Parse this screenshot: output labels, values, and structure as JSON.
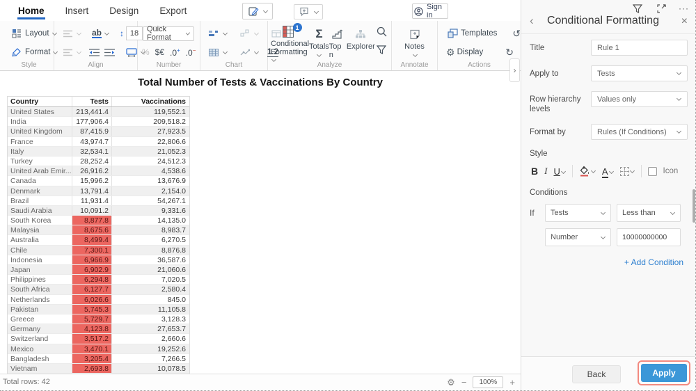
{
  "menubar": {
    "tabs": [
      {
        "label": "Home",
        "active": true
      },
      {
        "label": "Insert",
        "active": false
      },
      {
        "label": "Design",
        "active": false
      },
      {
        "label": "Export",
        "active": false
      }
    ],
    "sign_in_label": "Sign in"
  },
  "ribbon": {
    "style": {
      "label": "Style",
      "layout_label": "Layout",
      "format_label": "Format"
    },
    "align": {
      "label": "Align",
      "ab_label": "ab",
      "font_size": "18"
    },
    "number": {
      "label": "Number",
      "quick_format_label": "Quick Format",
      "percent": "%",
      "currency": "$€",
      "dec_plus": ".0",
      "dec_minus": ".0"
    },
    "chart": {
      "label": "Chart",
      "decimal_label": "1.2"
    },
    "analyze": {
      "label": "Analyze",
      "conditional_formatting_line1": "Conditional",
      "conditional_formatting_line2": "Formatting",
      "badge": "1",
      "totals_label": "Totals",
      "top_n_label": "Top n",
      "explorer_label": "Explorer"
    },
    "annotate": {
      "label": "Annotate",
      "notes_label": "Notes"
    },
    "actions": {
      "label": "Actions",
      "templates_label": "Templates",
      "display_label": "Display"
    }
  },
  "icons": {
    "undo": "↺",
    "redo": "↻",
    "resize": "↔",
    "gear": "⚙",
    "sigma": "Σ",
    "more": "···",
    "close": "×",
    "back": "‹",
    "collapse": "›",
    "minus": "−",
    "plus": "+",
    "updown": "↕",
    "excel_x": "x"
  },
  "report": {
    "title": "Total Number of Tests & Vaccinations By Country",
    "table": {
      "columns": [
        "Country",
        "Tests",
        "Vaccinations"
      ],
      "rows": [
        {
          "country": "United States",
          "tests": "213,441.4",
          "vaccinations": "119,552.1",
          "highlight": false
        },
        {
          "country": "India",
          "tests": "177,906.4",
          "vaccinations": "209,518.2",
          "highlight": false
        },
        {
          "country": "United Kingdom",
          "tests": "87,415.9",
          "vaccinations": "27,923.5",
          "highlight": false
        },
        {
          "country": "France",
          "tests": "43,974.7",
          "vaccinations": "22,806.6",
          "highlight": false
        },
        {
          "country": "Italy",
          "tests": "32,534.1",
          "vaccinations": "21,052.3",
          "highlight": false
        },
        {
          "country": "Turkey",
          "tests": "28,252.4",
          "vaccinations": "24,512.3",
          "highlight": false
        },
        {
          "country": "United Arab Emir...",
          "tests": "26,916.2",
          "vaccinations": "4,538.6",
          "highlight": false
        },
        {
          "country": "Canada",
          "tests": "15,996.2",
          "vaccinations": "13,676.9",
          "highlight": false
        },
        {
          "country": "Denmark",
          "tests": "13,791.4",
          "vaccinations": "2,154.0",
          "highlight": false
        },
        {
          "country": "Brazil",
          "tests": "11,931.4",
          "vaccinations": "54,267.1",
          "highlight": false
        },
        {
          "country": "Saudi Arabia",
          "tests": "10,091.2",
          "vaccinations": "9,331.6",
          "highlight": false
        },
        {
          "country": "South Korea",
          "tests": "8,877.8",
          "vaccinations": "14,135.0",
          "highlight": true
        },
        {
          "country": "Malaysia",
          "tests": "8,675.6",
          "vaccinations": "8,983.7",
          "highlight": true
        },
        {
          "country": "Australia",
          "tests": "8,499.4",
          "vaccinations": "6,270.5",
          "highlight": true
        },
        {
          "country": "Chile",
          "tests": "7,300.1",
          "vaccinations": "8,876.8",
          "highlight": true
        },
        {
          "country": "Indonesia",
          "tests": "6,966.9",
          "vaccinations": "36,587.6",
          "highlight": true
        },
        {
          "country": "Japan",
          "tests": "6,902.9",
          "vaccinations": "21,060.6",
          "highlight": true
        },
        {
          "country": "Philippines",
          "tests": "6,294.8",
          "vaccinations": "7,020.5",
          "highlight": true
        },
        {
          "country": "South Africa",
          "tests": "6,127.7",
          "vaccinations": "2,580.4",
          "highlight": true
        },
        {
          "country": "Netherlands",
          "tests": "6,026.6",
          "vaccinations": "845.0",
          "highlight": true
        },
        {
          "country": "Pakistan",
          "tests": "5,745.3",
          "vaccinations": "11,105.8",
          "highlight": true
        },
        {
          "country": "Greece",
          "tests": "5,729.7",
          "vaccinations": "3,128.3",
          "highlight": true
        },
        {
          "country": "Germany",
          "tests": "4,123.8",
          "vaccinations": "27,653.7",
          "highlight": true
        },
        {
          "country": "Switzerland",
          "tests": "3,517.2",
          "vaccinations": "2,660.6",
          "highlight": true
        },
        {
          "country": "Mexico",
          "tests": "3,470.1",
          "vaccinations": "19,252.6",
          "highlight": true
        },
        {
          "country": "Bangladesh",
          "tests": "3,205.4",
          "vaccinations": "7,266.5",
          "highlight": true
        },
        {
          "country": "Vietnam",
          "tests": "2,693.8",
          "vaccinations": "10,078.5",
          "highlight": true
        }
      ]
    }
  },
  "statusbar": {
    "total_rows": "Total rows: 42",
    "zoom_level": "100%"
  },
  "panel": {
    "title": "Conditional Formatting",
    "fields": {
      "title_label": "Title",
      "title_value": "Rule 1",
      "apply_to_label": "Apply to",
      "apply_to_value": "Tests",
      "row_hierarchy_label": "Row hierarchy levels",
      "row_hierarchy_value": "Values only",
      "format_by_label": "Format by",
      "format_by_value": "Rules (If Conditions)"
    },
    "style_label": "Style",
    "style_buttons": {
      "bold": "B",
      "italic": "I",
      "underline": "U",
      "font_color": "A",
      "icon_checkbox_label": "Icon"
    },
    "conditions": {
      "label": "Conditions",
      "if_label": "If",
      "field_value": "Tests",
      "operator_value": "Less than",
      "type_value": "Number",
      "threshold_value": "10000000000",
      "add_condition_label": "+ Add Condition"
    },
    "back_label": "Back",
    "apply_label": "Apply"
  },
  "colors": {
    "accent_blue": "#2368c4",
    "badge_blue": "#2e75cf",
    "apply_blue": "#3b97d8",
    "cell_red": "#ec6660",
    "highlight_outline_red": "#f28a80",
    "link_blue": "#2f80d0",
    "excel_green": "#1e7145"
  }
}
